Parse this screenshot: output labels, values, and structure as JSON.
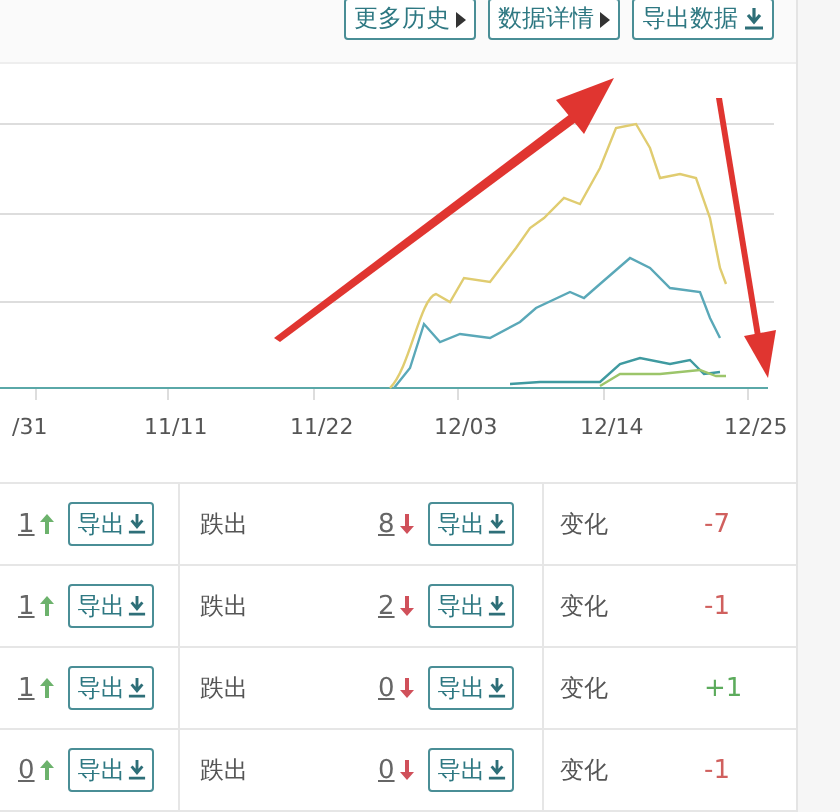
{
  "toolbar": {
    "buttons": [
      {
        "label": "更多历史",
        "kind": "more"
      },
      {
        "label": "数据详情",
        "kind": "more"
      },
      {
        "label": "导出数据",
        "kind": "export"
      }
    ]
  },
  "chart": {
    "x_labels": [
      "/31",
      "11/11",
      "11/22",
      "12/03",
      "12/14",
      "12/25"
    ]
  },
  "rows": [
    {
      "rise_count": "1",
      "rise_export": "导出",
      "fall_label": "跌出",
      "fall_count": "8",
      "fall_export": "导出",
      "change_label": "变化",
      "change": "-7",
      "color": "#d0605e"
    },
    {
      "rise_count": "1",
      "rise_export": "导出",
      "fall_label": "跌出",
      "fall_count": "2",
      "fall_export": "导出",
      "change_label": "变化",
      "change": "-1",
      "color": "#d0605e"
    },
    {
      "rise_count": "1",
      "rise_export": "导出",
      "fall_label": "跌出",
      "fall_count": "0",
      "fall_export": "导出",
      "change_label": "变化",
      "change": "+1",
      "color": "#5cab5c"
    },
    {
      "rise_count": "0",
      "rise_export": "导出",
      "fall_label": "跌出",
      "fall_count": "0",
      "fall_export": "导出",
      "change_label": "变化",
      "change": "-1",
      "color": "#d0605e"
    }
  ]
}
